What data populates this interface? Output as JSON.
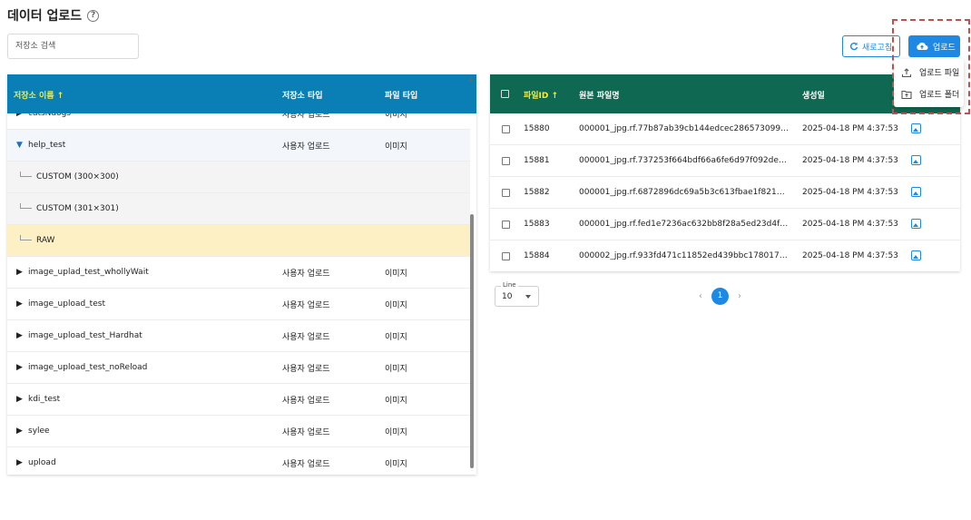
{
  "page": {
    "title": "데이터 업로드",
    "help_icon": "?"
  },
  "search": {
    "placeholder": "저장소 검색"
  },
  "repo_table": {
    "columns": [
      "저장소 이름 ↑",
      "저장소 타입",
      "파일 타입"
    ],
    "partial_row": {
      "name": "catsNdogs",
      "type": "사용자 업로드",
      "file_type": "이미지"
    },
    "rows": [
      {
        "name": "help_test",
        "type": "사용자 업로드",
        "file_type": "이미지",
        "expanded": true
      },
      {
        "name": "CUSTOM (300×300)",
        "child": true
      },
      {
        "name": "CUSTOM (301×301)",
        "child": true
      },
      {
        "name": "RAW",
        "child": true,
        "selected": true
      },
      {
        "name": "image_uplad_test_whollyWait",
        "type": "사용자 업로드",
        "file_type": "이미지"
      },
      {
        "name": "image_upload_test",
        "type": "사용자 업로드",
        "file_type": "이미지"
      },
      {
        "name": "image_upload_test_Hardhat",
        "type": "사용자 업로드",
        "file_type": "이미지"
      },
      {
        "name": "image_upload_test_noReload",
        "type": "사용자 업로드",
        "file_type": "이미지"
      },
      {
        "name": "kdi_test",
        "type": "사용자 업로드",
        "file_type": "이미지"
      },
      {
        "name": "sylee",
        "type": "사용자 업로드",
        "file_type": "이미지"
      },
      {
        "name": "upload",
        "type": "사용자 업로드",
        "file_type": "이미지"
      }
    ]
  },
  "file_table": {
    "columns": [
      "파일ID ↑",
      "원본 파일명",
      "생성일"
    ],
    "rows": [
      {
        "id": "15880",
        "filename": "000001_jpg.rf.77b87ab39cb144edcec286573099d...",
        "created": "2025-04-18 PM 4:37:53"
      },
      {
        "id": "15881",
        "filename": "000001_jpg.rf.737253f664bdf66a6fe6d97f092debe...",
        "created": "2025-04-18 PM 4:37:53"
      },
      {
        "id": "15882",
        "filename": "000001_jpg.rf.6872896dc69a5b3c613fbae1f82141...",
        "created": "2025-04-18 PM 4:37:53"
      },
      {
        "id": "15883",
        "filename": "000001_jpg.rf.fed1e7236ac632bb8f28a5ed23d4f5a...",
        "created": "2025-04-18 PM 4:37:53"
      },
      {
        "id": "15884",
        "filename": "000002_jpg.rf.933fd471c11852ed439bbc1780178...",
        "created": "2025-04-18 PM 4:37:53"
      }
    ]
  },
  "pagination": {
    "line_label": "Line",
    "line_value": "10",
    "current_page": "1",
    "prev": "‹",
    "next": "›"
  },
  "toolbar": {
    "refresh_label": "새로고침",
    "upload_label": "업로드"
  },
  "upload_menu": {
    "items": [
      "업로드 파일",
      "업로드 폴더"
    ]
  },
  "colors": {
    "repo_header": "#0a7fb5",
    "file_header": "#0f6952",
    "accent": "#1e88e5",
    "sort_highlight": "#f6ec3c",
    "selected_row": "#fdf0c4"
  },
  "icons": [
    "help-icon",
    "refresh-icon",
    "cloud-upload-icon",
    "file-upload-icon",
    "folder-upload-icon",
    "image-icon",
    "triangle-right-icon",
    "triangle-down-icon"
  ]
}
